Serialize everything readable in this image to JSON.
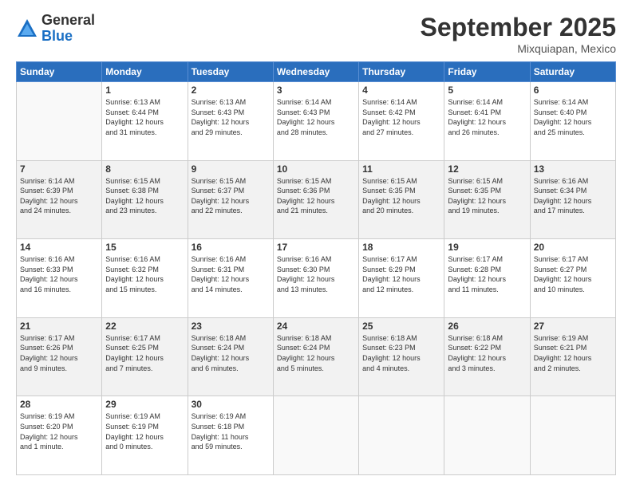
{
  "header": {
    "logo_general": "General",
    "logo_blue": "Blue",
    "month": "September 2025",
    "location": "Mixquiapan, Mexico"
  },
  "weekdays": [
    "Sunday",
    "Monday",
    "Tuesday",
    "Wednesday",
    "Thursday",
    "Friday",
    "Saturday"
  ],
  "weeks": [
    [
      {
        "day": "",
        "info": ""
      },
      {
        "day": "1",
        "info": "Sunrise: 6:13 AM\nSunset: 6:44 PM\nDaylight: 12 hours\nand 31 minutes."
      },
      {
        "day": "2",
        "info": "Sunrise: 6:13 AM\nSunset: 6:43 PM\nDaylight: 12 hours\nand 29 minutes."
      },
      {
        "day": "3",
        "info": "Sunrise: 6:14 AM\nSunset: 6:43 PM\nDaylight: 12 hours\nand 28 minutes."
      },
      {
        "day": "4",
        "info": "Sunrise: 6:14 AM\nSunset: 6:42 PM\nDaylight: 12 hours\nand 27 minutes."
      },
      {
        "day": "5",
        "info": "Sunrise: 6:14 AM\nSunset: 6:41 PM\nDaylight: 12 hours\nand 26 minutes."
      },
      {
        "day": "6",
        "info": "Sunrise: 6:14 AM\nSunset: 6:40 PM\nDaylight: 12 hours\nand 25 minutes."
      }
    ],
    [
      {
        "day": "7",
        "info": "Sunrise: 6:14 AM\nSunset: 6:39 PM\nDaylight: 12 hours\nand 24 minutes."
      },
      {
        "day": "8",
        "info": "Sunrise: 6:15 AM\nSunset: 6:38 PM\nDaylight: 12 hours\nand 23 minutes."
      },
      {
        "day": "9",
        "info": "Sunrise: 6:15 AM\nSunset: 6:37 PM\nDaylight: 12 hours\nand 22 minutes."
      },
      {
        "day": "10",
        "info": "Sunrise: 6:15 AM\nSunset: 6:36 PM\nDaylight: 12 hours\nand 21 minutes."
      },
      {
        "day": "11",
        "info": "Sunrise: 6:15 AM\nSunset: 6:35 PM\nDaylight: 12 hours\nand 20 minutes."
      },
      {
        "day": "12",
        "info": "Sunrise: 6:15 AM\nSunset: 6:35 PM\nDaylight: 12 hours\nand 19 minutes."
      },
      {
        "day": "13",
        "info": "Sunrise: 6:16 AM\nSunset: 6:34 PM\nDaylight: 12 hours\nand 17 minutes."
      }
    ],
    [
      {
        "day": "14",
        "info": "Sunrise: 6:16 AM\nSunset: 6:33 PM\nDaylight: 12 hours\nand 16 minutes."
      },
      {
        "day": "15",
        "info": "Sunrise: 6:16 AM\nSunset: 6:32 PM\nDaylight: 12 hours\nand 15 minutes."
      },
      {
        "day": "16",
        "info": "Sunrise: 6:16 AM\nSunset: 6:31 PM\nDaylight: 12 hours\nand 14 minutes."
      },
      {
        "day": "17",
        "info": "Sunrise: 6:16 AM\nSunset: 6:30 PM\nDaylight: 12 hours\nand 13 minutes."
      },
      {
        "day": "18",
        "info": "Sunrise: 6:17 AM\nSunset: 6:29 PM\nDaylight: 12 hours\nand 12 minutes."
      },
      {
        "day": "19",
        "info": "Sunrise: 6:17 AM\nSunset: 6:28 PM\nDaylight: 12 hours\nand 11 minutes."
      },
      {
        "day": "20",
        "info": "Sunrise: 6:17 AM\nSunset: 6:27 PM\nDaylight: 12 hours\nand 10 minutes."
      }
    ],
    [
      {
        "day": "21",
        "info": "Sunrise: 6:17 AM\nSunset: 6:26 PM\nDaylight: 12 hours\nand 9 minutes."
      },
      {
        "day": "22",
        "info": "Sunrise: 6:17 AM\nSunset: 6:25 PM\nDaylight: 12 hours\nand 7 minutes."
      },
      {
        "day": "23",
        "info": "Sunrise: 6:18 AM\nSunset: 6:24 PM\nDaylight: 12 hours\nand 6 minutes."
      },
      {
        "day": "24",
        "info": "Sunrise: 6:18 AM\nSunset: 6:24 PM\nDaylight: 12 hours\nand 5 minutes."
      },
      {
        "day": "25",
        "info": "Sunrise: 6:18 AM\nSunset: 6:23 PM\nDaylight: 12 hours\nand 4 minutes."
      },
      {
        "day": "26",
        "info": "Sunrise: 6:18 AM\nSunset: 6:22 PM\nDaylight: 12 hours\nand 3 minutes."
      },
      {
        "day": "27",
        "info": "Sunrise: 6:19 AM\nSunset: 6:21 PM\nDaylight: 12 hours\nand 2 minutes."
      }
    ],
    [
      {
        "day": "28",
        "info": "Sunrise: 6:19 AM\nSunset: 6:20 PM\nDaylight: 12 hours\nand 1 minute."
      },
      {
        "day": "29",
        "info": "Sunrise: 6:19 AM\nSunset: 6:19 PM\nDaylight: 12 hours\nand 0 minutes."
      },
      {
        "day": "30",
        "info": "Sunrise: 6:19 AM\nSunset: 6:18 PM\nDaylight: 11 hours\nand 59 minutes."
      },
      {
        "day": "",
        "info": ""
      },
      {
        "day": "",
        "info": ""
      },
      {
        "day": "",
        "info": ""
      },
      {
        "day": "",
        "info": ""
      }
    ]
  ]
}
